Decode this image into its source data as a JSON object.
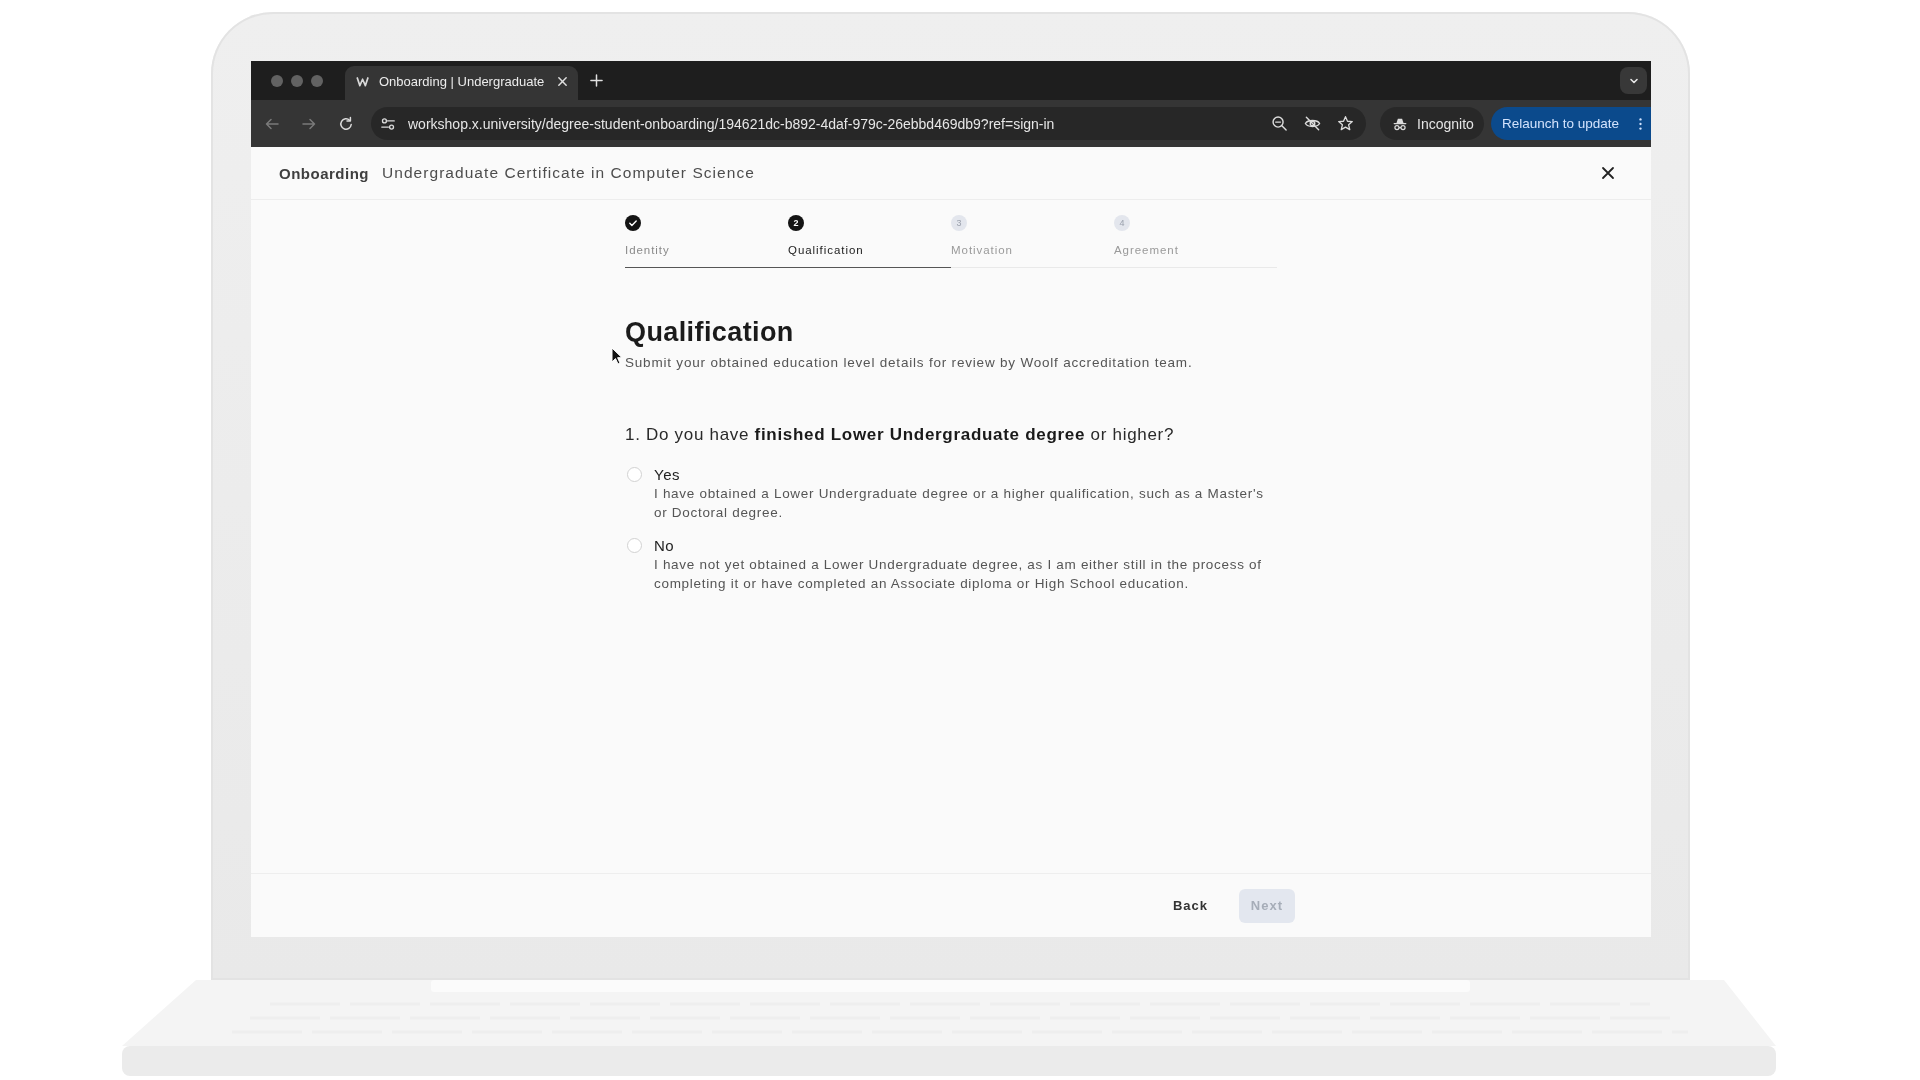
{
  "browser": {
    "tabs": [
      {
        "title": "Onboarding | Undergraduate",
        "selected": true
      }
    ],
    "url": "workshop.x.university/degree-student-onboarding/194621dc-b892-4daf-979c-26ebbd469db9?ref=sign-in",
    "profile_label": "Incognito",
    "update_button": "Relaunch to update"
  },
  "page_header": {
    "section": "Onboarding",
    "program": "Undergraduate Certificate in Computer Science"
  },
  "stepper": {
    "steps": [
      {
        "label": "Identity",
        "completed": true,
        "current": false
      },
      {
        "number": "2",
        "label": "Qualification",
        "completed": false,
        "current": true
      },
      {
        "number": "3",
        "label": "Motivation",
        "completed": false,
        "current": false
      },
      {
        "number": "4",
        "label": "Agreement",
        "completed": false,
        "current": false
      }
    ]
  },
  "form": {
    "title": "Qualification",
    "subtitle": "Submit your obtained education level details for review by Woolf accreditation team.",
    "question": "1. Do you have **finished Lower Undergraduate degree** or higher?",
    "options": [
      {
        "label": "Yes",
        "description": "I have obtained a Lower Undergraduate degree or a higher qualification, such as a Master's or Doctoral degree.",
        "selected": false
      },
      {
        "label": "No",
        "description": "I have not yet obtained a Lower Undergraduate degree, as I am either still in the process of completing it or have completed an Associate diploma or High School education.",
        "selected": false
      }
    ]
  },
  "footer": {
    "back_button": "Back",
    "next_button": {
      "label": "Next",
      "disabled": true
    }
  }
}
